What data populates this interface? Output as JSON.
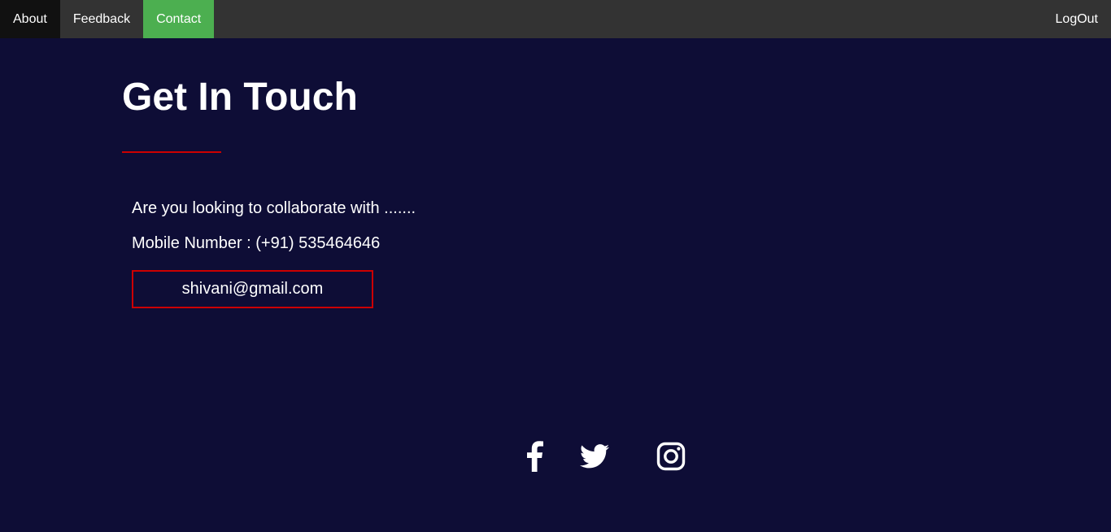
{
  "nav": {
    "items": [
      {
        "label": "About"
      },
      {
        "label": "Feedback"
      },
      {
        "label": "Contact"
      }
    ],
    "logout_label": "LogOut",
    "active_color": "#4caf50"
  },
  "contact": {
    "title": "Get In Touch",
    "intro": "Are you looking to collaborate with .......",
    "mobile": "Mobile Number : (+91) 535464646",
    "email": "shivani@gmail.com"
  },
  "social": {
    "icons": [
      "facebook-icon",
      "twitter-icon",
      "instagram-icon"
    ]
  },
  "colors": {
    "background": "#0e0d36",
    "navbar": "#333333",
    "accent_red": "#cc0000"
  }
}
